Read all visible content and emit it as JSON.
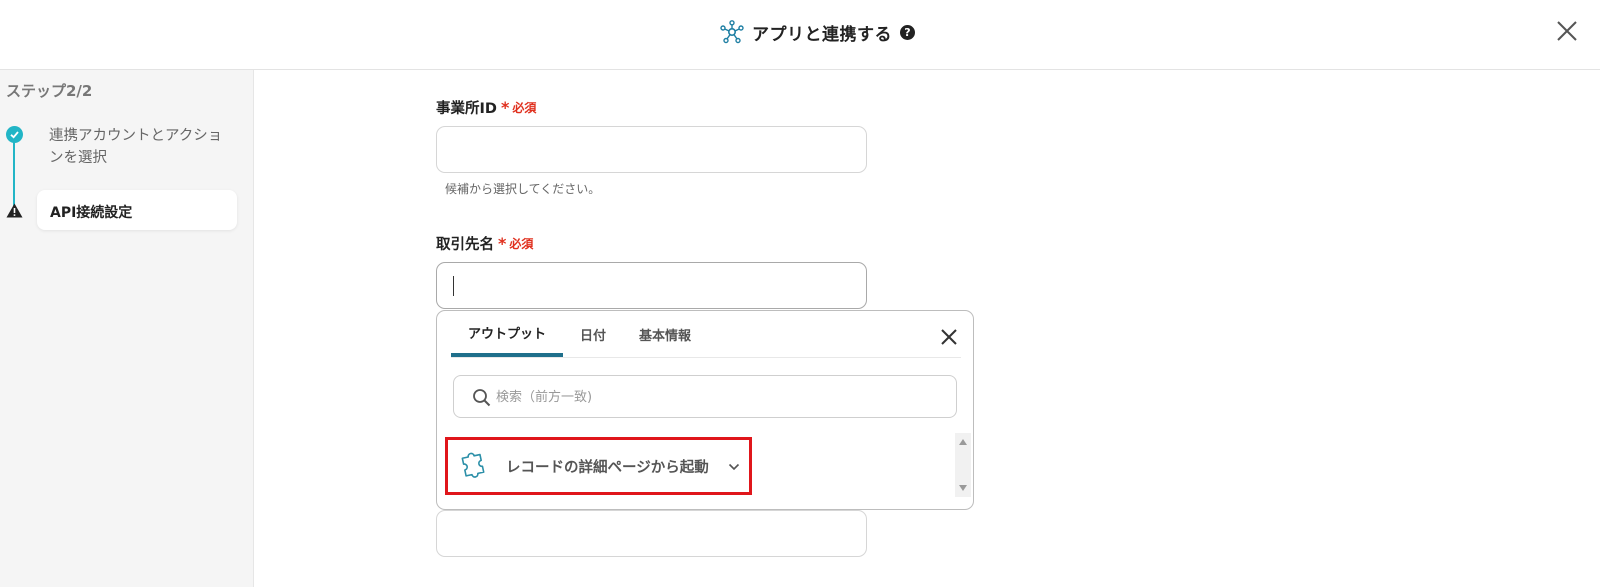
{
  "header": {
    "title": "アプリと連携する",
    "help_glyph": "?",
    "close_icon": "close-icon",
    "title_icon": "network-icon"
  },
  "sidebar": {
    "step_heading": "ステップ2/2",
    "steps": [
      {
        "label": "連携アカウントとアクションを選択",
        "status": "completed",
        "icon": "check-icon"
      },
      {
        "label": "API接続設定",
        "status": "warning",
        "icon": "warning-icon"
      }
    ]
  },
  "form": {
    "office_id": {
      "label": "事業所ID",
      "required_mark": "*",
      "required_text": "必須",
      "value": "",
      "hint": "候補から選択してください。"
    },
    "partner_name": {
      "label": "取引先名",
      "required_mark": "*",
      "required_text": "必須",
      "value": ""
    },
    "next_field_value": ""
  },
  "popup": {
    "tabs": [
      {
        "label": "アウトプット",
        "active": true
      },
      {
        "label": "日付",
        "active": false
      },
      {
        "label": "基本情報",
        "active": false
      }
    ],
    "search_placeholder": "検索（前方一致)",
    "items": [
      {
        "label": "レコードの詳細ページから起動",
        "icon": "puzzle-icon",
        "expanded": false,
        "highlighted": true
      }
    ]
  },
  "colors": {
    "accent": "#22b5c6",
    "tab_underline": "#1f6f8b",
    "required": "#e0301e",
    "highlight_border": "#e0161b"
  }
}
